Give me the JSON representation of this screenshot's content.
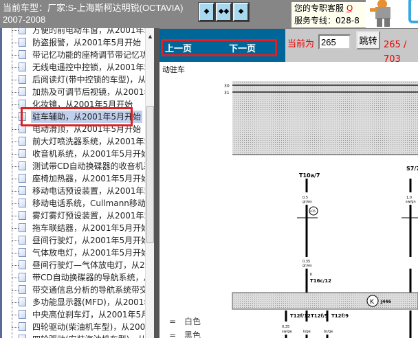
{
  "header": {
    "title_line1": "当前车型：厂家:S-上海斯柯达明锐(OCTAVIA)",
    "title_line2": "2007-2008",
    "buttons": [
      "first-page",
      "dual-page",
      "last-page"
    ],
    "service": {
      "label": "您的专职客服",
      "link": "Q",
      "hotline": "服务专线：028-8"
    }
  },
  "tree": {
    "items": [
      "方便的前电动车窗，从2001年5月开始",
      "防盗报警，从2001年5月开始",
      "带记忆功能的座椅调节带记忆功能",
      "无线电遥控中控锁，从2001年5月",
      "后阅读灯(带中控锁的车型)，从2001",
      "加热及可调节后视镜，从2001年5月",
      "化妆镜，从2001年5月开始",
      "驻车辅助，从2001年5月开始",
      "电动滑顶，从2001年5月开始",
      "前大灯喷洗器系统，从2001年5月",
      "收音机系统，从2001年5月开始",
      "测试带CD自动换碟器的收音机系统",
      "座椅加热器，从2001年5月开始",
      "移动电话预设装置，从2001年5月",
      "移动电话系统，Cullmann移动电话",
      "雾灯雾灯预设装置，从2001年5月",
      "拖车联结器，从2001年5月开始",
      "昼间行驶灯，从2001年5月开始(不",
      "气体放电灯，从2001年5月开始",
      "昼间行驶灯—气体放电灯，从2001",
      "带CD自动换碟器的导航系统，从2001",
      "带交通信息分析的导航系统带交通",
      "多功能显示器(MFD)，从2001年5月",
      "中央高位刹车灯，从2001年5月开始",
      "四轮驱动(柴油机车型)，从2001年5月",
      "四轮驱动(安装汽油机车型)，从2001"
    ],
    "selected_index": 7
  },
  "nav": {
    "prev": "上一页",
    "next": "下一页",
    "current_label": "当前为",
    "current_value": "265",
    "go": "跳转",
    "total": "265 / 703"
  },
  "document": {
    "title": "动驻车",
    "legend": [
      "=　白色",
      "=　黑色"
    ],
    "diagram": {
      "bus": [
        "30",
        "31"
      ],
      "labels": [
        "T10a/7",
        "S7/7a",
        "0,5",
        "gr/ws",
        "1,0",
        "sw/gn",
        "A76",
        "0,35",
        "gr/ws",
        "K",
        "T16c/12",
        "J446",
        "T12f/12",
        "T12f/5",
        "T12f/9",
        "0,35",
        "sw/ge",
        "li/ge",
        "br/ge"
      ]
    }
  }
}
